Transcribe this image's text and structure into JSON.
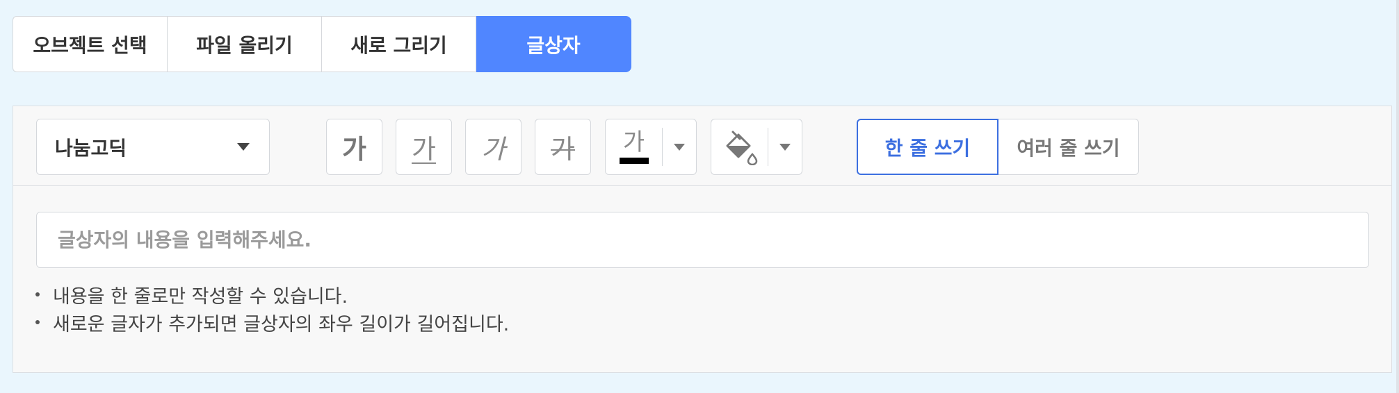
{
  "tabs": [
    {
      "label": "오브젝트 선택",
      "active": false
    },
    {
      "label": "파일 올리기",
      "active": false
    },
    {
      "label": "새로 그리기",
      "active": false
    },
    {
      "label": "글상자",
      "active": true
    }
  ],
  "toolbar": {
    "font_select_value": "나눔고딕",
    "bold_glyph": "가",
    "underline_glyph": "가",
    "italic_glyph": "가",
    "strike_glyph": "가",
    "text_color_glyph": "가",
    "text_color": "#000000",
    "fill_icon": "paint-bucket-icon",
    "single_line_label": "한 줄 쓰기",
    "multi_line_label": "여러 줄 쓰기"
  },
  "input": {
    "placeholder": "글상자의 내용을 입력해주세요.",
    "value": ""
  },
  "notes": [
    "내용을 한 줄로만 작성할 수 있습니다.",
    "새로운 글자가 추가되면 글상자의 좌우 길이가 길어집니다."
  ],
  "colors": {
    "accent": "#5086ff",
    "selected_border": "#3c6fe0",
    "background": "#eaf6fd"
  }
}
